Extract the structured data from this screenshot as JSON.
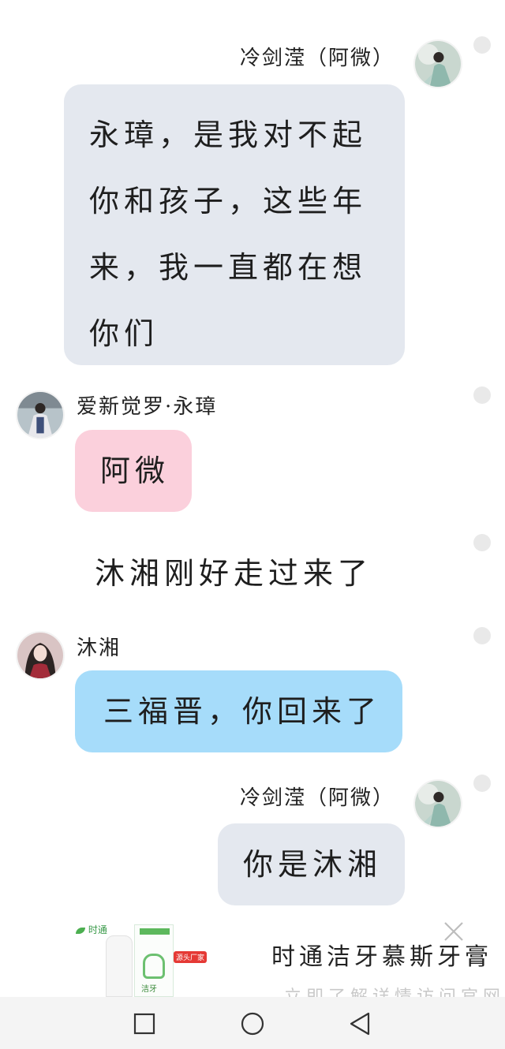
{
  "messages": [
    {
      "id": "m1",
      "sender": "冷剑滢（阿微）",
      "align": "right",
      "lines": [
        "永璋，是我对不起",
        "你和孩子，这些年",
        "来，我一直都在想",
        "你们"
      ]
    },
    {
      "id": "m2",
      "sender": "爱新觉罗·永璋",
      "align": "left",
      "lines": [
        "阿微"
      ]
    },
    {
      "id": "m3",
      "narration": "沐湘刚好走过来了"
    },
    {
      "id": "m4",
      "sender": "沐湘",
      "align": "left",
      "lines": [
        "三福晋，你回来了"
      ]
    },
    {
      "id": "m5",
      "sender": "冷剑滢（阿微）",
      "align": "right",
      "lines": [
        "你是沐湘"
      ]
    }
  ],
  "ad": {
    "brand": "时通",
    "tag": "源头厂家",
    "product_label": "洁牙",
    "title": "时通洁牙慕斯牙膏",
    "subtitle": "立即了解详情访问官网"
  },
  "colors": {
    "bubble_grey": "#e4e8ef",
    "bubble_pink": "#fbd0dc",
    "bubble_blue": "#a6dcfa"
  },
  "icons": {
    "ad_close": "close-icon",
    "nav_recents": "square-icon",
    "nav_home": "circle-icon",
    "nav_back": "triangle-back-icon"
  }
}
